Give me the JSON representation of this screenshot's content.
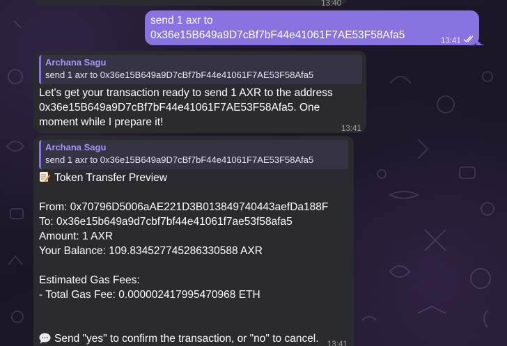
{
  "chat": {
    "top_partial_time": "13:40",
    "sent": {
      "line1": "send 1 axr to",
      "line2": "0x36e15B649a9D7cBf7bF44e41061F7AE53F58Afa5",
      "time": "13:41"
    },
    "reply1": {
      "quote_name": "Archana Sagu",
      "quote_text": "send 1 axr to 0x36e15B649a9D7cBf7bF44e41061F7AE53F58Afa5",
      "lines": [
        "Let's get your transaction ready to send 1 AXR to the address",
        "0x36e15B649a9D7cBf7bF44e41061F7AE53F58Afa5. One",
        "moment while I prepare it!"
      ],
      "time": "13:41"
    },
    "reply2": {
      "quote_name": "Archana Sagu",
      "quote_text": "send 1 axr to 0x36e15B649a9D7cBf7bF44e41061F7AE53F58Afa5",
      "title": "Token Transfer Preview",
      "from": "From: 0x70796D5006aAE221D3B013849740443aefDa188F",
      "to": "To: 0x36e15b649a9d7cbf7bf44e41061f7ae53f58afa5",
      "amount": "Amount: 1 AXR",
      "balance": "Your Balance: 109.834527745286330588 AXR",
      "gas_title": "Estimated Gas Fees:",
      "gas_total": "- Total Gas Fee: 0.000002417995470968 ETH",
      "confirm": "Send \"yes\" to confirm the transaction, or \"no\" to cancel.",
      "time": "13:41"
    },
    "icons": {
      "memo": "memo-emoji-icon",
      "speech": "speech-bubble-emoji-icon",
      "read": "double-check-icon"
    },
    "colors": {
      "outgoing": "#8774e1",
      "incoming": "#2b2b2f",
      "accent": "#a594f5"
    }
  }
}
